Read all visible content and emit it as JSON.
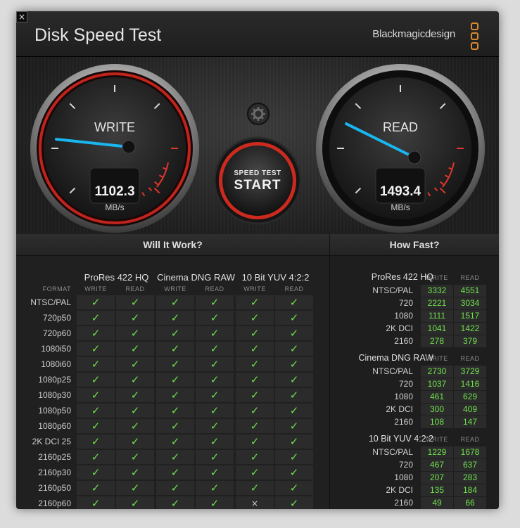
{
  "window": {
    "title": "Disk Speed Test",
    "brand": "Blackmagicdesign",
    "close_label": "×"
  },
  "gauges": {
    "write": {
      "label": "WRITE",
      "value": "1102.3",
      "unit": "MB/s"
    },
    "read": {
      "label": "READ",
      "value": "1493.4",
      "unit": "MB/s"
    },
    "start_button": {
      "line1": "SPEED TEST",
      "line2": "START"
    }
  },
  "will_it_work": {
    "title": "Will It Work?",
    "format_label": "FORMAT",
    "codecs": [
      "ProRes 422 HQ",
      "Cinema DNG RAW",
      "10 Bit YUV 4:2:2"
    ],
    "sub_headers": [
      "WRITE",
      "READ"
    ],
    "rows": [
      {
        "format": "NTSC/PAL",
        "cells": [
          true,
          true,
          true,
          true,
          true,
          true
        ]
      },
      {
        "format": "720p50",
        "cells": [
          true,
          true,
          true,
          true,
          true,
          true
        ]
      },
      {
        "format": "720p60",
        "cells": [
          true,
          true,
          true,
          true,
          true,
          true
        ]
      },
      {
        "format": "1080i50",
        "cells": [
          true,
          true,
          true,
          true,
          true,
          true
        ]
      },
      {
        "format": "1080i60",
        "cells": [
          true,
          true,
          true,
          true,
          true,
          true
        ]
      },
      {
        "format": "1080p25",
        "cells": [
          true,
          true,
          true,
          true,
          true,
          true
        ]
      },
      {
        "format": "1080p30",
        "cells": [
          true,
          true,
          true,
          true,
          true,
          true
        ]
      },
      {
        "format": "1080p50",
        "cells": [
          true,
          true,
          true,
          true,
          true,
          true
        ]
      },
      {
        "format": "1080p60",
        "cells": [
          true,
          true,
          true,
          true,
          true,
          true
        ]
      },
      {
        "format": "2K DCI 25",
        "cells": [
          true,
          true,
          true,
          true,
          true,
          true
        ]
      },
      {
        "format": "2160p25",
        "cells": [
          true,
          true,
          true,
          true,
          true,
          true
        ]
      },
      {
        "format": "2160p30",
        "cells": [
          true,
          true,
          true,
          true,
          true,
          true
        ]
      },
      {
        "format": "2160p50",
        "cells": [
          true,
          true,
          true,
          true,
          true,
          true
        ]
      },
      {
        "format": "2160p60",
        "cells": [
          true,
          true,
          true,
          true,
          false,
          true
        ]
      }
    ],
    "check_glyph": "✓",
    "cross_glyph": "×"
  },
  "how_fast": {
    "title": "How Fast?",
    "sub_headers": [
      "WRITE",
      "READ"
    ],
    "groups": [
      {
        "codec": "ProRes 422 HQ",
        "rows": [
          {
            "label": "NTSC/PAL",
            "write": "3332",
            "read": "4551"
          },
          {
            "label": "720",
            "write": "2221",
            "read": "3034"
          },
          {
            "label": "1080",
            "write": "1111",
            "read": "1517"
          },
          {
            "label": "2K DCI",
            "write": "1041",
            "read": "1422"
          },
          {
            "label": "2160",
            "write": "278",
            "read": "379"
          }
        ]
      },
      {
        "codec": "Cinema DNG RAW",
        "rows": [
          {
            "label": "NTSC/PAL",
            "write": "2730",
            "read": "3729"
          },
          {
            "label": "720",
            "write": "1037",
            "read": "1416"
          },
          {
            "label": "1080",
            "write": "461",
            "read": "629"
          },
          {
            "label": "2K DCI",
            "write": "300",
            "read": "409"
          },
          {
            "label": "2160",
            "write": "108",
            "read": "147"
          }
        ]
      },
      {
        "codec": "10 Bit YUV 4:2:2",
        "rows": [
          {
            "label": "NTSC/PAL",
            "write": "1229",
            "read": "1678"
          },
          {
            "label": "720",
            "write": "467",
            "read": "637"
          },
          {
            "label": "1080",
            "write": "207",
            "read": "283"
          },
          {
            "label": "2K DCI",
            "write": "135",
            "read": "184"
          },
          {
            "label": "2160",
            "write": "49",
            "read": "66"
          }
        ]
      }
    ]
  },
  "colors": {
    "accent_green": "#6ee04c",
    "needle_blue": "#19b6f0",
    "redline": "#e0362a",
    "brand_orange": "#d98a2b"
  }
}
